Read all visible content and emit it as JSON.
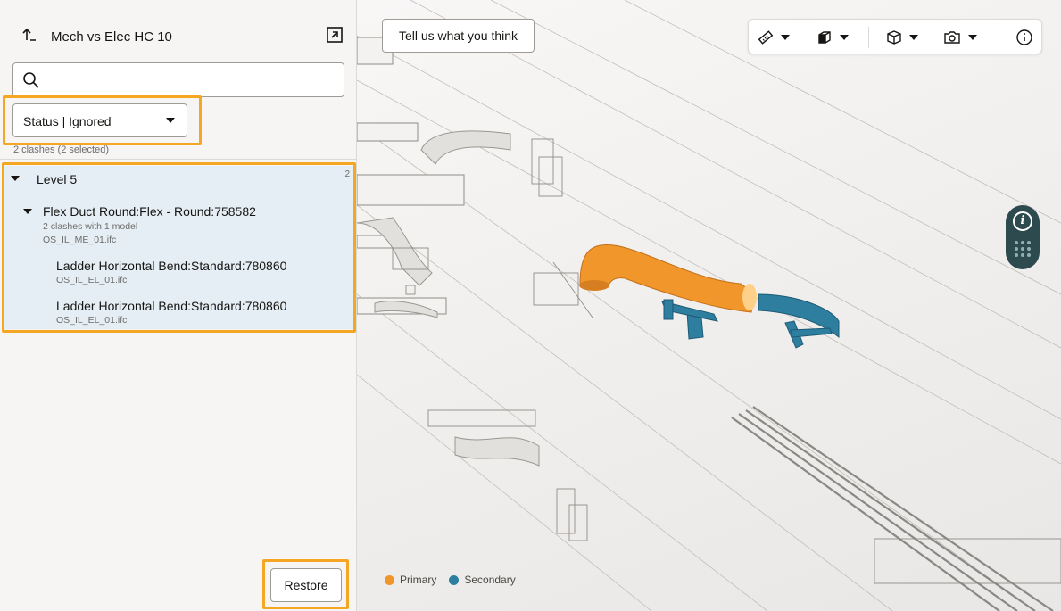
{
  "panel": {
    "title": "Mech vs Elec HC 10",
    "search": {
      "placeholder": "",
      "value": ""
    },
    "status_dropdown": {
      "label": "Status | Ignored"
    },
    "clash_count": "2 clashes (2 selected)",
    "restore_label": "Restore"
  },
  "tree": {
    "group": {
      "label": "Level 5",
      "count": "2"
    },
    "primary": {
      "label": "Flex Duct Round:Flex - Round:758582",
      "summary": "2 clashes with 1 model",
      "model": "OS_IL_ME_01.ifc"
    },
    "children": [
      {
        "label": "Ladder Horizontal Bend:Standard:780860",
        "model": "OS_IL_EL_01.ifc"
      },
      {
        "label": "Ladder Horizontal Bend:Standard:780860",
        "model": "OS_IL_EL_01.ifc"
      }
    ]
  },
  "viewport": {
    "feedback_label": "Tell us what you think",
    "toolbar": [
      "ruler-icon",
      "box-icon",
      "section-box-icon",
      "camera-settings-icon",
      "info-icon"
    ],
    "legend": [
      {
        "label": "Primary",
        "color": "#f0962a"
      },
      {
        "label": "Secondary",
        "color": "#2e7ea0"
      }
    ]
  },
  "colors": {
    "highlight": "#f5a623",
    "selection": "#e4eef4",
    "pill": "#2d4a4e"
  }
}
